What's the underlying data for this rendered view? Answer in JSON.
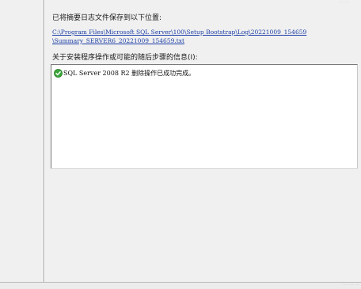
{
  "saved_label": "已将摘要日志文件保存到以下位置:",
  "log_path": {
    "line1": "C:\\Program Files\\Microsoft SQL Server\\100\\Setup Bootstrap\\Log\\20221009_154659",
    "line2": "\\Summary_SERVER6_20221009_154659.txt"
  },
  "info_label": "关于安装程序操作或可能的随后步骤的信息(I):",
  "info_box": {
    "status_icon": "success-check-icon",
    "message": "SQL Server 2008 R2 删除操作已成功完成。"
  },
  "colors": {
    "link": "#1a3da6",
    "background": "#f0f0f0",
    "success": "#3aa63a"
  }
}
